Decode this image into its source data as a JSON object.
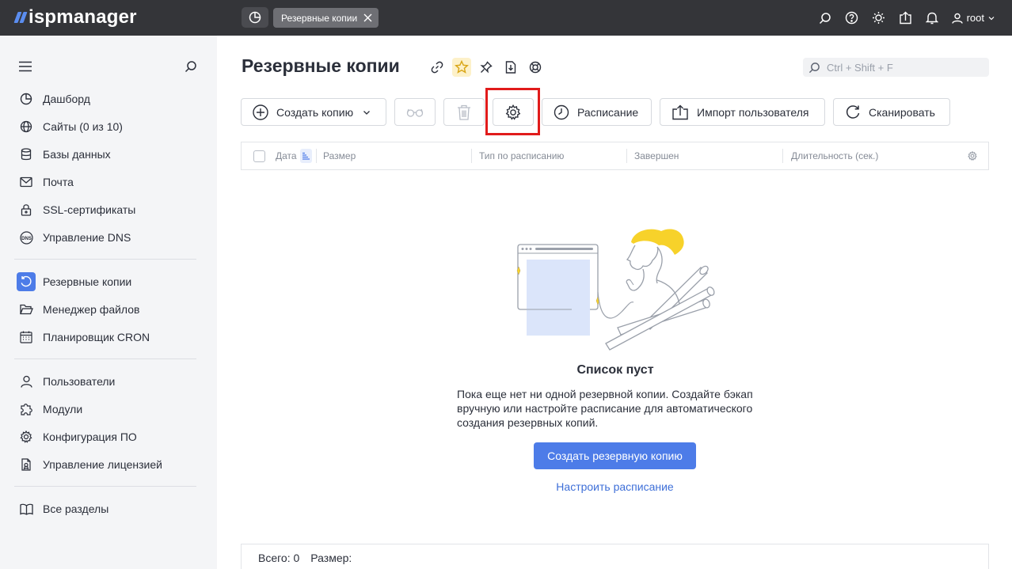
{
  "app": {
    "logo_text": "ispmanager"
  },
  "topbar": {
    "tab_label": "Резервные копии",
    "user": "root",
    "icons": [
      "search-icon",
      "help-icon",
      "theme-icon",
      "upload-icon",
      "bell-icon",
      "user-icon"
    ]
  },
  "sidebar": {
    "group1": [
      {
        "label": "Дашборд",
        "icon": "dashboard-icon"
      },
      {
        "label": "Сайты (0 из 10)",
        "icon": "globe-icon"
      },
      {
        "label": "Базы данных",
        "icon": "database-icon"
      },
      {
        "label": "Почта",
        "icon": "mail-icon"
      },
      {
        "label": "SSL-сертификаты",
        "icon": "lock-icon"
      },
      {
        "label": "Управление DNS",
        "icon": "dns-icon",
        "icon_text": "DNS"
      }
    ],
    "group2": [
      {
        "label": "Резервные копии",
        "icon": "backup-icon",
        "active": true
      },
      {
        "label": "Менеджер файлов",
        "icon": "folder-icon"
      },
      {
        "label": "Планировщик CRON",
        "icon": "calendar-icon"
      }
    ],
    "group3": [
      {
        "label": "Пользователи",
        "icon": "user-icon"
      },
      {
        "label": "Модули",
        "icon": "puzzle-icon"
      },
      {
        "label": "Конфигурация ПО",
        "icon": "settings-icon"
      },
      {
        "label": "Управление лицензией",
        "icon": "license-icon"
      }
    ],
    "group4": [
      {
        "label": "Все разделы",
        "icon": "book-icon"
      }
    ]
  },
  "main": {
    "title": "Резервные копии",
    "search_placeholder": "Ctrl + Shift + F",
    "toolbar": {
      "create_label": "Создать копию",
      "schedule_label": "Расписание",
      "import_label": "Импорт пользователя",
      "scan_label": "Сканировать"
    },
    "table": {
      "columns": [
        "Дата",
        "Размер",
        "Тип по расписанию",
        "Завершен",
        "Длительность (сек.)"
      ]
    },
    "empty": {
      "title": "Список пуст",
      "text": "Пока еще нет ни одной резервной копии. Создайте бэкап вручную или настройте расписание для автоматического создания резервных копий.",
      "primary_button": "Создать резервную копию",
      "link": "Настроить расписание"
    },
    "footer": {
      "total": "Всего: 0",
      "size": "Размер:"
    }
  },
  "colors": {
    "topbar": "#343539",
    "accent": "#4d7ce8",
    "highlight": "#e11b1b",
    "sidebar_bg": "#f4f5f7",
    "illustration_yellow": "#f7d22a"
  }
}
